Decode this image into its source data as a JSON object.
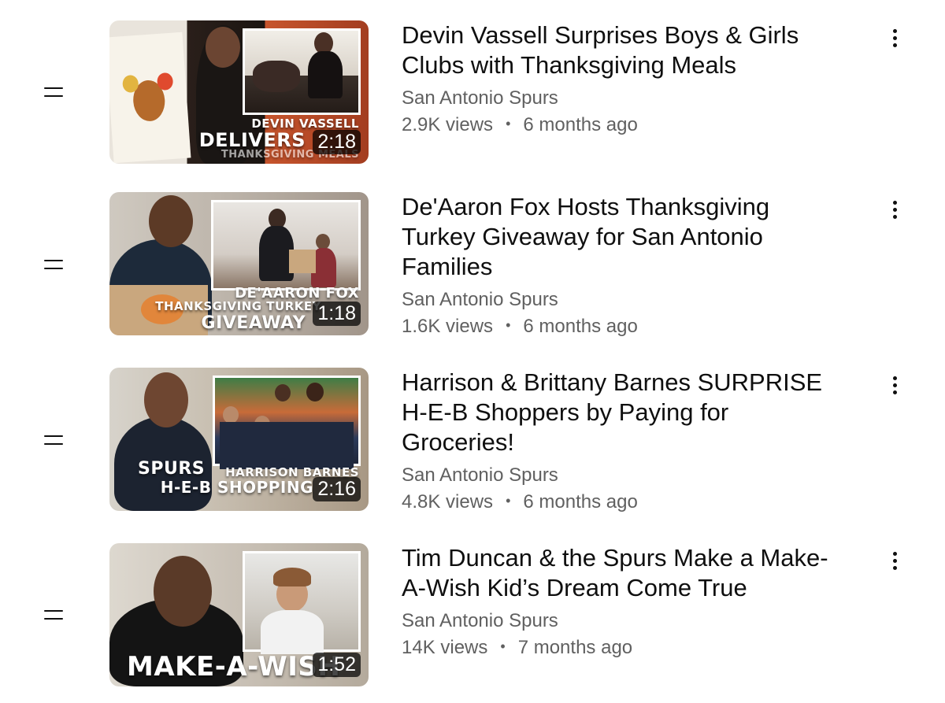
{
  "accent": "#0f0f0f",
  "secondary_text_color": "#606060",
  "separator": "•",
  "videos": [
    {
      "title": "Devin Vassell Surprises Boys & Girls Clubs with Thanksgiving Meals",
      "channel": "San Antonio Spurs",
      "views": "2.9K views",
      "age": "6 months ago",
      "duration": "2:18",
      "thumb_text_1": "DEVIN VASSELL",
      "thumb_text_2": "DELIVERS",
      "thumb_text_3": "THANKSGIVING MEALS"
    },
    {
      "title": "De'Aaron Fox Hosts Thanksgiving Turkey Giveaway for San Antonio Families",
      "channel": "San Antonio Spurs",
      "views": "1.6K views",
      "age": "6 months ago",
      "duration": "1:18",
      "thumb_text_1": "DE'AARON FOX",
      "thumb_text_2": "THANKSGIVING TURKEY",
      "thumb_text_3": "GIVEAWAY"
    },
    {
      "title": "Harrison & Brittany Barnes SURPRISE H-E-B Shoppers by Paying for Groceries!",
      "channel": "San Antonio Spurs",
      "views": "4.8K views",
      "age": "6 months ago",
      "duration": "2:16",
      "thumb_text_1": "HARRISON BARNES",
      "thumb_text_2": "H-E-B SHOPPING",
      "thumb_text_3": "SPURS"
    },
    {
      "title": "Tim Duncan & the Spurs Make a Make-A-Wish Kid’s Dream Come True",
      "channel": "San Antonio Spurs",
      "views": "14K views",
      "age": "7 months ago",
      "duration": "1:52",
      "thumb_text_1": "MAKE-A-WISH"
    }
  ]
}
